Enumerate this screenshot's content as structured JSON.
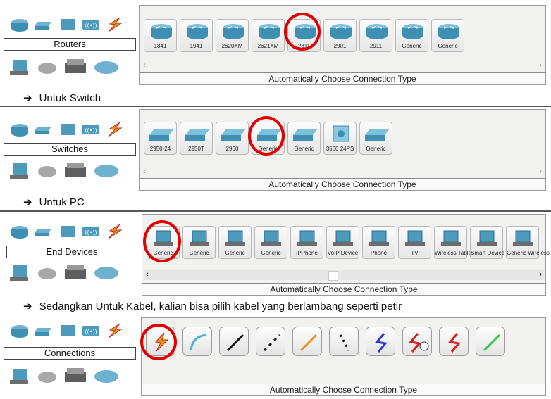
{
  "sections": [
    {
      "category": "Routers",
      "devices": [
        "1841",
        "1941",
        "2620XM",
        "2621XM",
        "2811",
        "2901",
        "2911",
        "Generic",
        "Generic"
      ],
      "selected": "2811",
      "status": "Automatically Choose Connection Type"
    },
    {
      "category": "Switches",
      "devices": [
        "2950-24",
        "2950T",
        "2960",
        "Generic",
        "Generic",
        "3560 24PS",
        "Generic"
      ],
      "selected": "Generic",
      "status": "Automatically Choose Connection Type"
    },
    {
      "category": "End Devices",
      "devices": [
        "Generic",
        "Generic",
        "Generic",
        "Generic",
        "IPPhone",
        "VoIP Device",
        "Phone",
        "TV",
        "Wireless Tablet",
        "Smart Device",
        "Generic Wireless"
      ],
      "selected": "Generic",
      "status": "Automatically Choose Connection Type"
    },
    {
      "category": "Connections",
      "connections": [
        "Automatic",
        "Console",
        "Copper Straight-Through",
        "Copper Cross-Over",
        "Fiber",
        "Phone",
        "Coaxial",
        "Serial DCE",
        "Serial DTE",
        "Octal"
      ],
      "selected": "Automatic",
      "status": "Automatically Choose Connection Type"
    }
  ],
  "captions": {
    "switch": "Untuk Switch",
    "pc": "Untuk PC",
    "cable": "Sedangkan Untuk Kabel, kalian bisa pilih kabel yang berlambang seperti petir"
  },
  "icons": {
    "arrow": "➔",
    "scroll_left": "‹",
    "scroll_right": "›"
  },
  "colors": {
    "device_teal": "#4aa3c6",
    "highlight_red": "#e00000",
    "lightning_orange": "#e39a12"
  }
}
